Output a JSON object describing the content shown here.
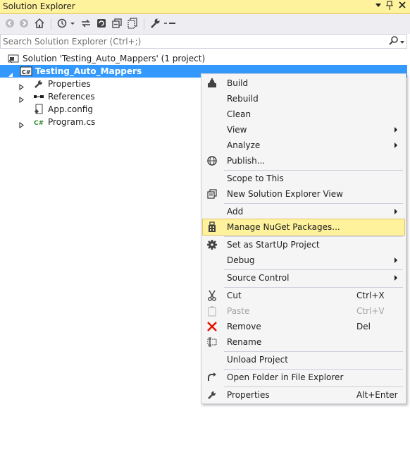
{
  "window": {
    "title": "Solution Explorer",
    "dropdown_glyph": "▼",
    "pin_glyph": "📌",
    "close_glyph": "✕"
  },
  "toolbar": {
    "icons": [
      "back-icon",
      "forward-icon",
      "home-icon",
      "history-icon",
      "sync-icon",
      "refresh-icon",
      "collapse-all-icon",
      "show-all-files-icon",
      "properties-wrench-icon",
      "preview-icon"
    ]
  },
  "search": {
    "placeholder": "Search Solution Explorer (Ctrl+;)"
  },
  "tree": {
    "solution": "Solution 'Testing_Auto_Mappers' (1 project)",
    "project": "Testing_Auto_Mappers",
    "items": [
      {
        "label": "Properties",
        "icon": "wrench-icon"
      },
      {
        "label": "References",
        "icon": "references-icon"
      },
      {
        "label": "App.config",
        "icon": "config-icon"
      },
      {
        "label": "Program.cs",
        "icon": "csharp-file-icon"
      }
    ]
  },
  "menu": {
    "build": "Build",
    "rebuild": "Rebuild",
    "clean": "Clean",
    "view": "View",
    "analyze": "Analyze",
    "publish": "Publish...",
    "scope": "Scope to This",
    "new_view": "New Solution Explorer View",
    "add": "Add",
    "nuget": "Manage NuGet Packages...",
    "startup": "Set as StartUp Project",
    "debug": "Debug",
    "source_control": "Source Control",
    "cut": "Cut",
    "cut_sc": "Ctrl+X",
    "paste": "Paste",
    "paste_sc": "Ctrl+V",
    "remove": "Remove",
    "remove_sc": "Del",
    "rename": "Rename",
    "unload": "Unload Project",
    "open_folder": "Open Folder in File Explorer",
    "properties": "Properties",
    "properties_sc": "Alt+Enter"
  },
  "colors": {
    "title_bg": "#fff29d",
    "selection": "#3399ff",
    "highlight": "#fff29d",
    "menu_bg": "#f5f5f5",
    "remove_red": "#e51400",
    "csharp_green": "#388a34"
  }
}
